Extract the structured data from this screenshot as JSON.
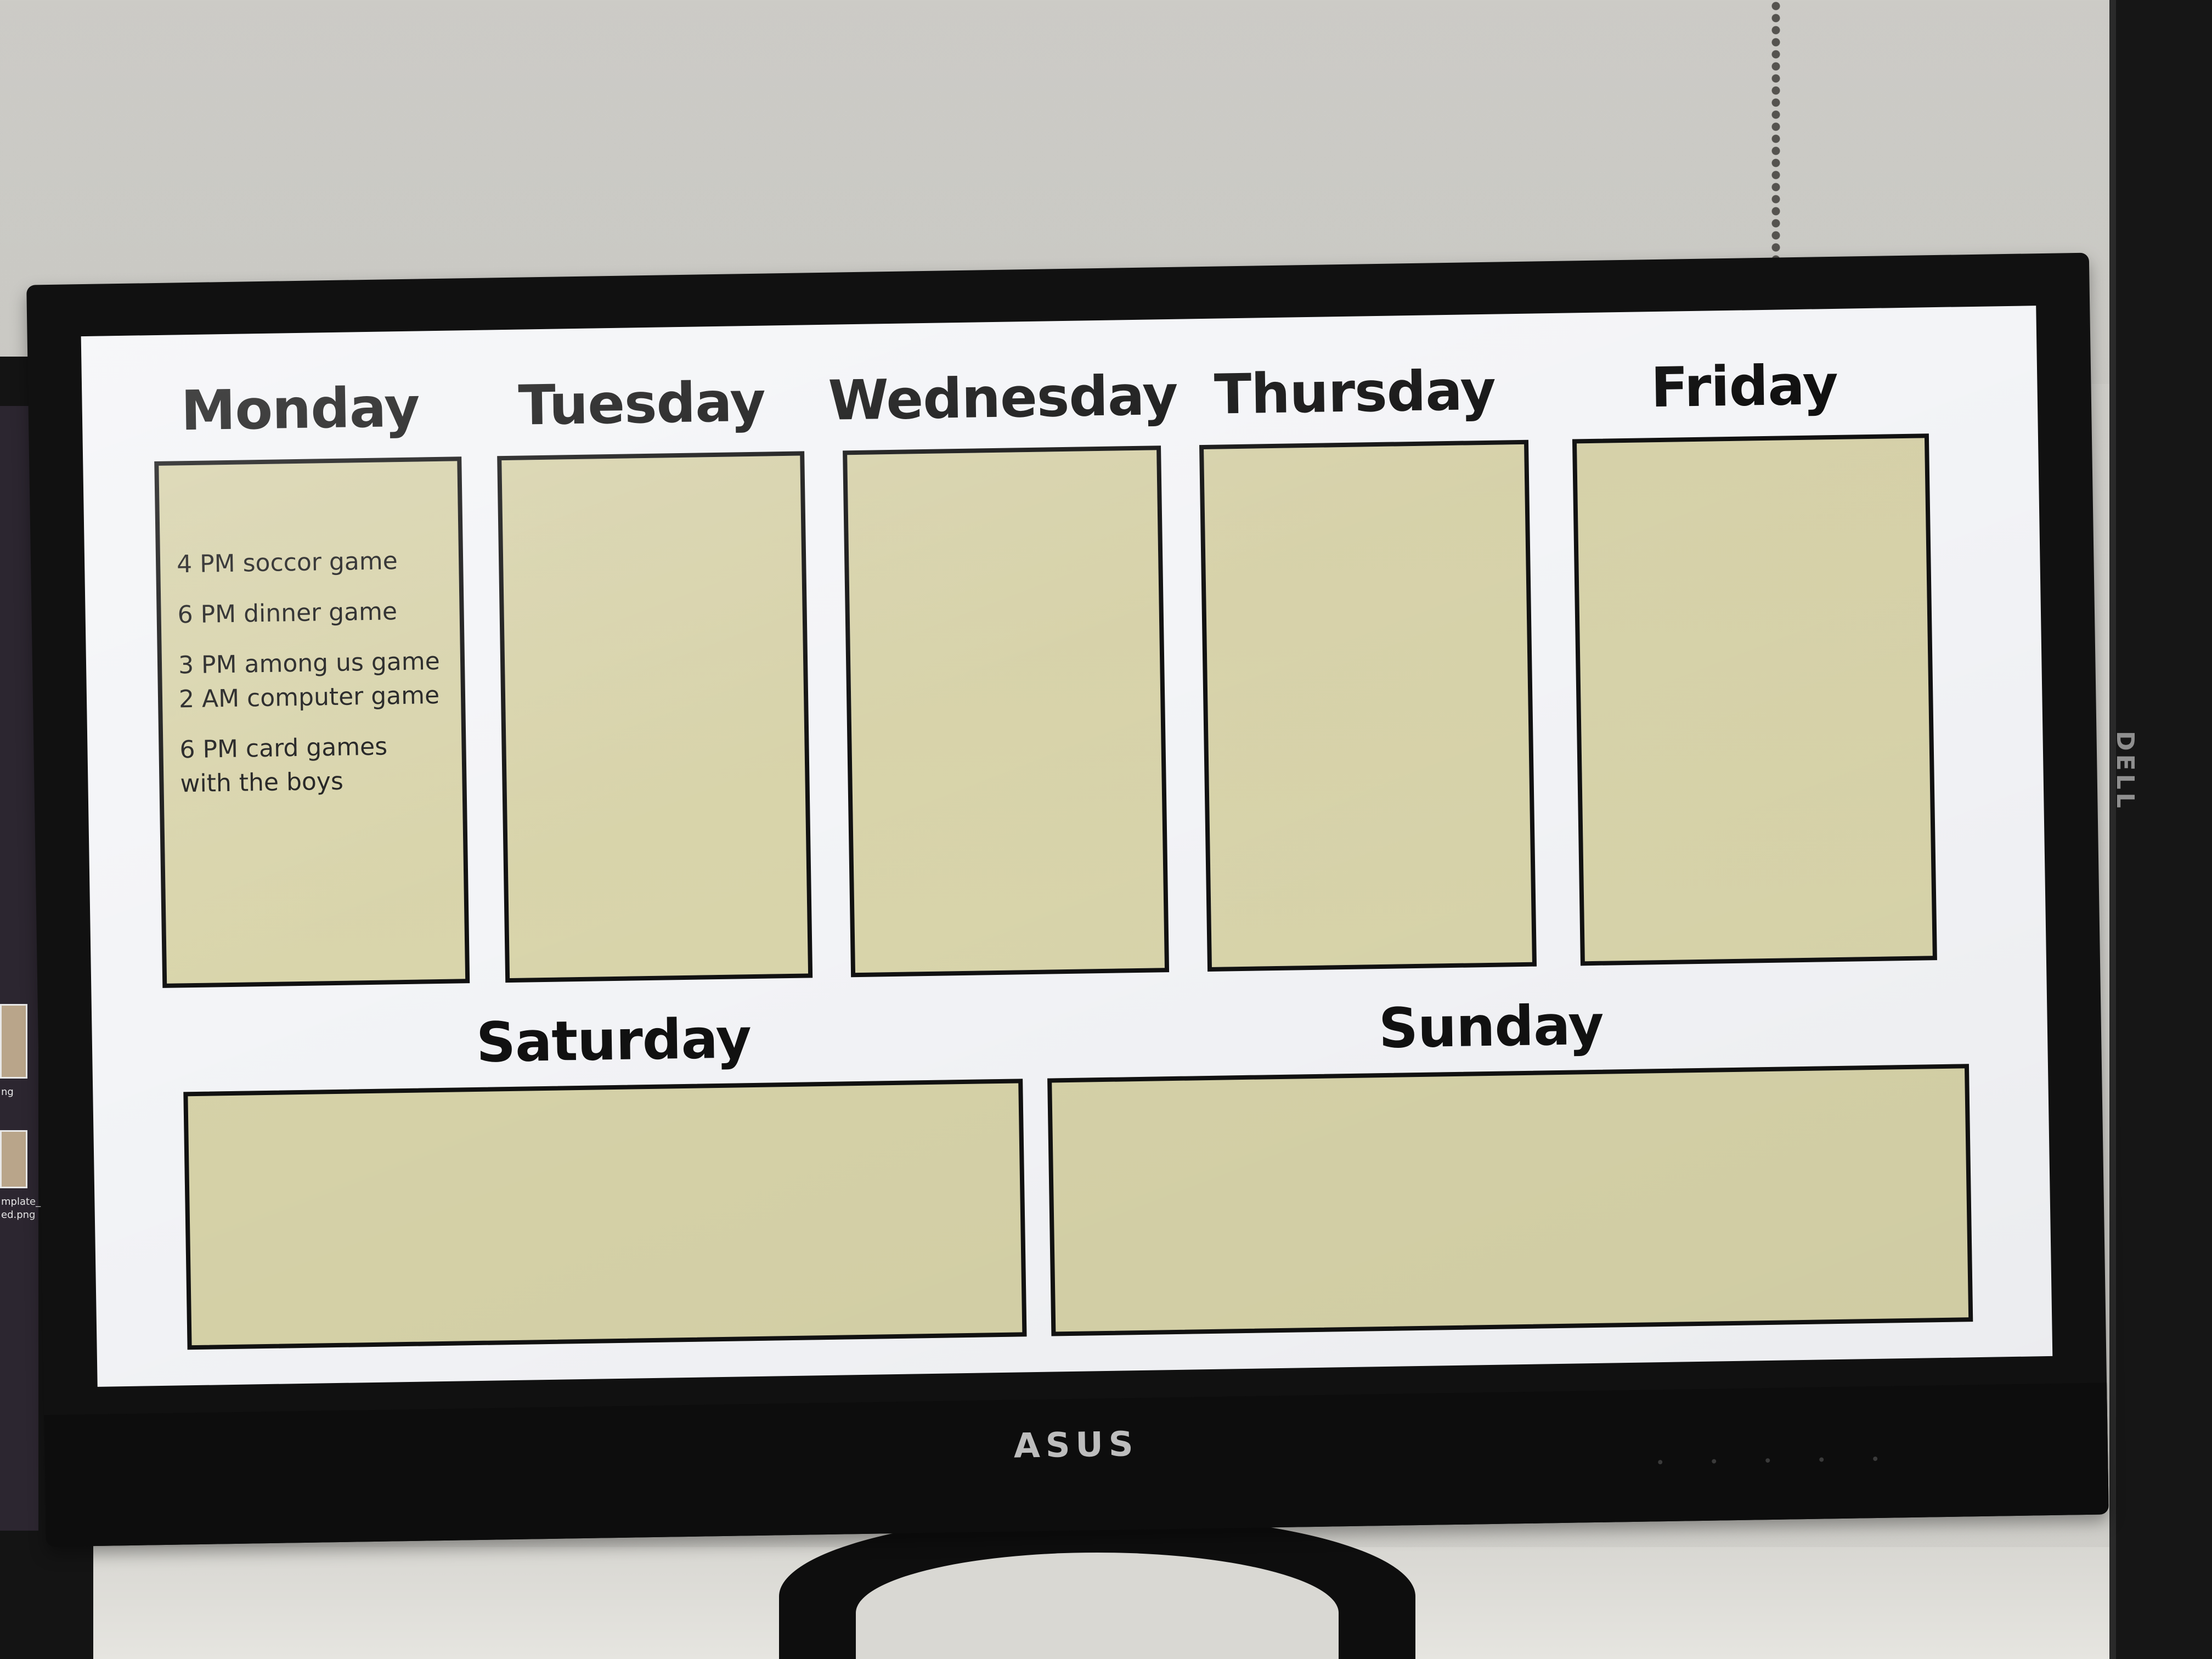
{
  "planner": {
    "days": {
      "monday": {
        "title": "Monday",
        "events": [
          "4 PM soccor game",
          "6 PM dinner game",
          "3 PM among us game\n2 AM computer game",
          "6 PM card games\nwith the boys"
        ]
      },
      "tuesday": {
        "title": "Tuesday",
        "events": []
      },
      "wednesday": {
        "title": "Wednesday",
        "events": []
      },
      "thursday": {
        "title": "Thursday",
        "events": []
      },
      "friday": {
        "title": "Friday",
        "events": []
      },
      "saturday": {
        "title": "Saturday",
        "events": []
      },
      "sunday": {
        "title": "Sunday",
        "events": []
      }
    }
  },
  "hardware": {
    "monitor_brand": "ASUS",
    "side_monitor_brand": "DELL"
  },
  "side_monitor_desktop": {
    "labels": [
      "ng",
      "mplate_a",
      "ed.png"
    ]
  },
  "colors": {
    "box_fill": "#d6d2a8",
    "box_border": "#111111",
    "screen_background": "#f3f4f7",
    "text": "#111111"
  }
}
